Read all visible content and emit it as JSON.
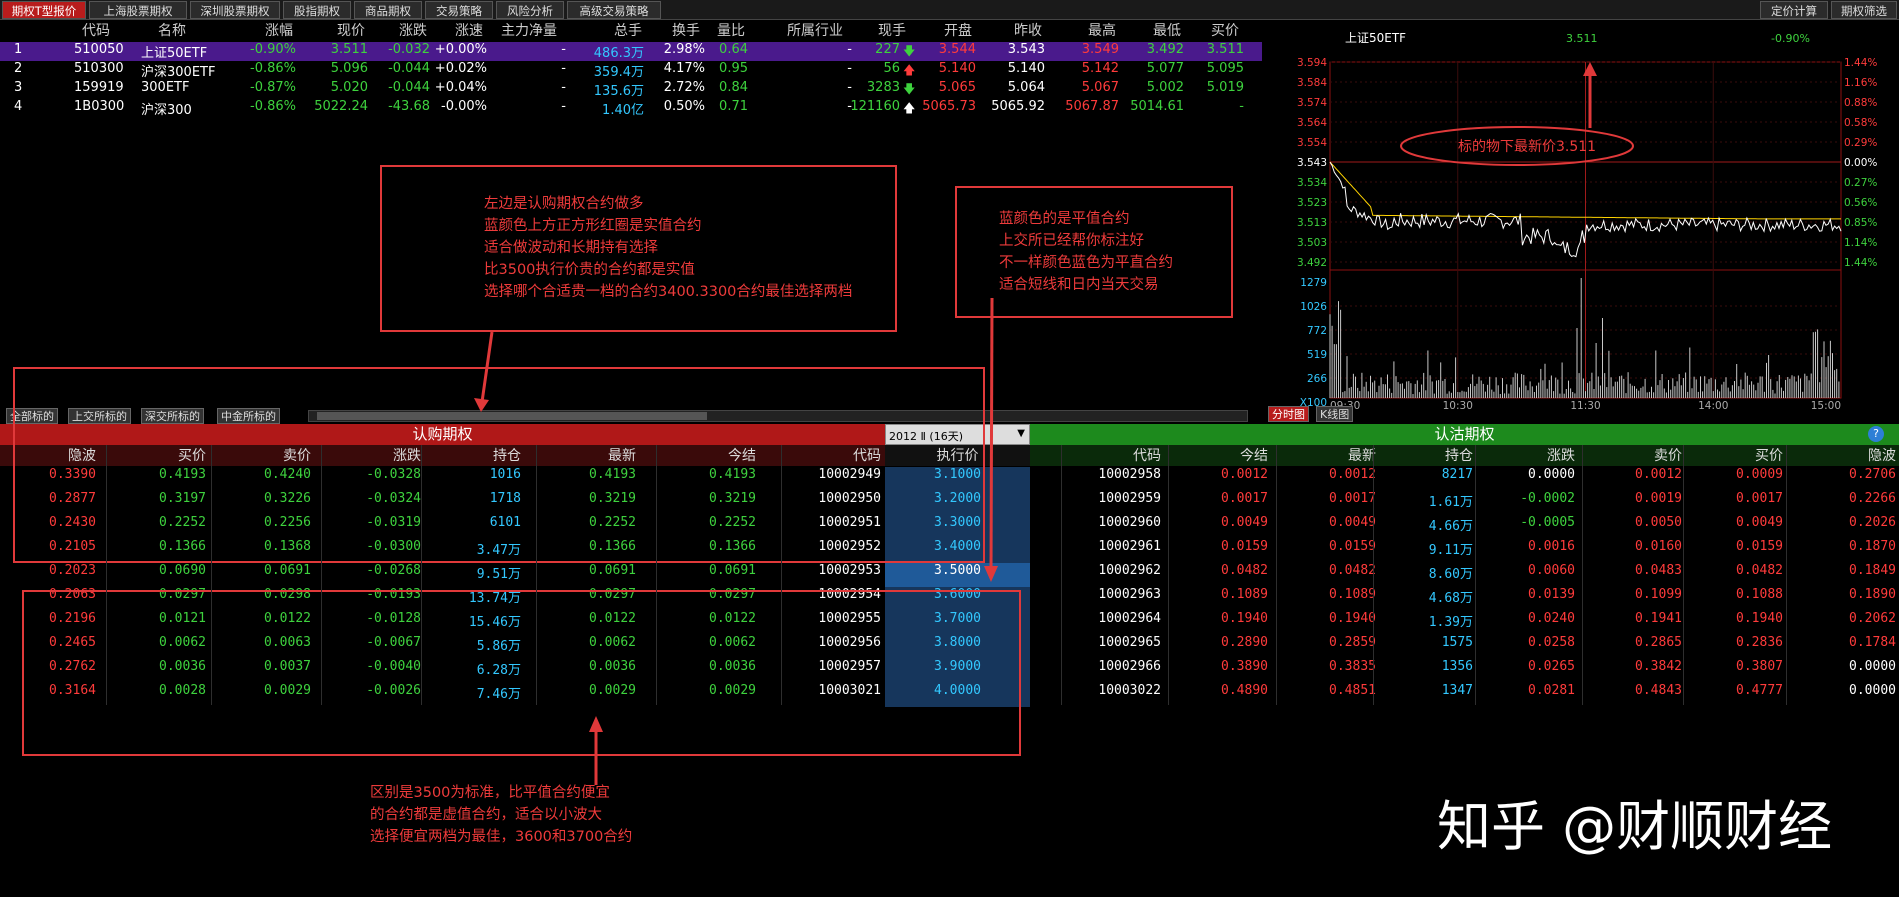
{
  "tabs": [
    "期权T型报价",
    "上海股票期权",
    "深圳股票期权",
    "股指期权",
    "商品期权",
    "交易策略",
    "风险分析",
    "高级交易策略"
  ],
  "right_tabs": [
    "定价计算",
    "期权筛选"
  ],
  "quote_headers": [
    "代码",
    "名称",
    "涨幅",
    "现价",
    "涨跌",
    "涨速",
    "主力净量",
    "总手",
    "换手",
    "量比",
    "所属行业",
    "现手",
    "开盘",
    "昨收",
    "最高",
    "最低",
    "买价"
  ],
  "quotes": [
    {
      "idx": "1",
      "code": "510050",
      "name": "上证50ETF",
      "pct": "-0.90%",
      "price": "3.511",
      "chg": "-0.032",
      "speed": "+0.00%",
      "net": "-",
      "vol": "486.3万",
      "turn": "2.98%",
      "ratio": "0.64",
      "ind": "-",
      "cur": "227",
      "arrow": "down",
      "open": "3.544",
      "prev": "3.543",
      "high": "3.549",
      "low": "3.492",
      "bid": "3.511"
    },
    {
      "idx": "2",
      "code": "510300",
      "name": "沪深300ETF",
      "pct": "-0.86%",
      "price": "5.096",
      "chg": "-0.044",
      "speed": "+0.02%",
      "net": "-",
      "vol": "359.4万",
      "turn": "4.17%",
      "ratio": "0.95",
      "ind": "-",
      "cur": "56",
      "arrow": "up",
      "open": "5.140",
      "prev": "5.140",
      "high": "5.142",
      "low": "5.077",
      "bid": "5.095"
    },
    {
      "idx": "3",
      "code": "159919",
      "name": "300ETF",
      "pct": "-0.87%",
      "price": "5.020",
      "chg": "-0.044",
      "speed": "+0.04%",
      "net": "-",
      "vol": "135.6万",
      "turn": "2.72%",
      "ratio": "0.84",
      "ind": "-",
      "cur": "3283",
      "arrow": "down",
      "open": "5.065",
      "prev": "5.064",
      "high": "5.067",
      "low": "5.002",
      "bid": "5.019"
    },
    {
      "idx": "4",
      "code": "1B0300",
      "name": "沪深300",
      "pct": "-0.86%",
      "price": "5022.24",
      "chg": "-43.68",
      "speed": "-0.00%",
      "net": "-",
      "vol": "1.40亿",
      "turn": "0.50%",
      "ratio": "0.71",
      "ind": "-",
      "cur": "121160",
      "arrow": "up",
      "open": "5065.73",
      "prev": "5065.92",
      "high": "5067.87",
      "low": "5014.61",
      "bid": "-"
    }
  ],
  "annotations": {
    "box1": [
      "左边是认购期权合约做多",
      "蓝颜色上方正方形红圈是实值合约",
      "适合做波动和长期持有选择",
      "比3500执行价贵的合约都是实值",
      "选择哪个合适贵一档的合约3400.3300合约最佳选择两档"
    ],
    "box2": [
      "蓝颜色的是平值合约",
      "上交所已经帮你标注好",
      "不一样颜色蓝色为平直合约",
      "适合短线和日内当天交易"
    ],
    "box3": [
      "区别是3500为标准，比平值合约便宜",
      "的合约都是虚值合约，适合以小波大",
      "选择便宜两档为最佳，3600和3700合约"
    ],
    "ellipse": "标的物下最新价3.511"
  },
  "chart": {
    "title": "上证50ETF",
    "price": "3.511",
    "pct": "-0.90%",
    "price_ticks": [
      "3.594",
      "3.584",
      "3.574",
      "3.564",
      "3.554",
      "3.543",
      "3.534",
      "3.523",
      "3.513",
      "3.503",
      "3.492"
    ],
    "pct_ticks": [
      "1.44%",
      "1.16%",
      "0.88%",
      "0.58%",
      "0.29%",
      "0.00%",
      "0.27%",
      "0.56%",
      "0.85%",
      "1.14%",
      "1.44%"
    ],
    "vol_ticks": [
      "1279",
      "1026",
      "772",
      "519",
      "266",
      "X100"
    ],
    "time_ticks": [
      "09:30",
      "10:30",
      "11:30",
      "14:00",
      "15:00"
    ],
    "tabs": [
      "分时图",
      "K线图"
    ]
  },
  "market_tabs": [
    "全部标的",
    "上交所标的",
    "深交所标的",
    "中金所标的"
  ],
  "call_banner": "认购期权",
  "put_banner": "认沽期权",
  "expiry_select": "2012 Ⅱ  (16天)",
  "call_headers": [
    "隐波",
    "买价",
    "卖价",
    "涨跌",
    "持仓",
    "最新",
    "今结",
    "代码"
  ],
  "strike_header": "执行价",
  "put_headers": [
    "代码",
    "今结",
    "最新",
    "持仓",
    "涨跌",
    "卖价",
    "买价",
    "隐波"
  ],
  "options": [
    {
      "c": [
        "0.3390",
        "0.4193",
        "0.4240",
        "-0.0328",
        "1016",
        "0.4193",
        "0.4193",
        "10002949"
      ],
      "k": "3.1000",
      "p": [
        "10002958",
        "0.0012",
        "0.0012",
        "8217",
        "0.0000",
        "0.0012",
        "0.0009",
        "0.2706"
      ]
    },
    {
      "c": [
        "0.2877",
        "0.3197",
        "0.3226",
        "-0.0324",
        "1718",
        "0.3219",
        "0.3219",
        "10002950"
      ],
      "k": "3.2000",
      "p": [
        "10002959",
        "0.0017",
        "0.0017",
        "1.61万",
        "-0.0002",
        "0.0019",
        "0.0017",
        "0.2266"
      ]
    },
    {
      "c": [
        "0.2430",
        "0.2252",
        "0.2256",
        "-0.0319",
        "6101",
        "0.2252",
        "0.2252",
        "10002951"
      ],
      "k": "3.3000",
      "p": [
        "10002960",
        "0.0049",
        "0.0049",
        "4.66万",
        "-0.0005",
        "0.0050",
        "0.0049",
        "0.2026"
      ]
    },
    {
      "c": [
        "0.2105",
        "0.1366",
        "0.1368",
        "-0.0300",
        "3.47万",
        "0.1366",
        "0.1366",
        "10002952"
      ],
      "k": "3.4000",
      "p": [
        "10002961",
        "0.0159",
        "0.0159",
        "9.11万",
        "0.0016",
        "0.0160",
        "0.0159",
        "0.1870"
      ]
    },
    {
      "c": [
        "0.2023",
        "0.0690",
        "0.0691",
        "-0.0268",
        "9.51万",
        "0.0691",
        "0.0691",
        "10002953"
      ],
      "k": "3.5000",
      "p": [
        "10002962",
        "0.0482",
        "0.0482",
        "8.60万",
        "0.0060",
        "0.0483",
        "0.0482",
        "0.1849"
      ],
      "atm": true
    },
    {
      "c": [
        "0.2063",
        "0.0297",
        "0.0298",
        "-0.0193",
        "13.74万",
        "0.0297",
        "0.0297",
        "10002954"
      ],
      "k": "3.6000",
      "p": [
        "10002963",
        "0.1089",
        "0.1089",
        "4.68万",
        "0.0139",
        "0.1099",
        "0.1088",
        "0.1890"
      ]
    },
    {
      "c": [
        "0.2196",
        "0.0121",
        "0.0122",
        "-0.0128",
        "15.46万",
        "0.0122",
        "0.0122",
        "10002955"
      ],
      "k": "3.7000",
      "p": [
        "10002964",
        "0.1940",
        "0.1940",
        "1.39万",
        "0.0240",
        "0.1941",
        "0.1940",
        "0.2062"
      ]
    },
    {
      "c": [
        "0.2465",
        "0.0062",
        "0.0063",
        "-0.0067",
        "5.86万",
        "0.0062",
        "0.0062",
        "10002956"
      ],
      "k": "3.8000",
      "p": [
        "10002965",
        "0.2890",
        "0.2859",
        "1575",
        "0.0258",
        "0.2865",
        "0.2836",
        "0.1784"
      ]
    },
    {
      "c": [
        "0.2762",
        "0.0036",
        "0.0037",
        "-0.0040",
        "6.28万",
        "0.0036",
        "0.0036",
        "10002957"
      ],
      "k": "3.9000",
      "p": [
        "10002966",
        "0.3890",
        "0.3835",
        "1356",
        "0.0265",
        "0.3842",
        "0.3807",
        "0.0000"
      ]
    },
    {
      "c": [
        "0.3164",
        "0.0028",
        "0.0029",
        "-0.0026",
        "7.46万",
        "0.0029",
        "0.0029",
        "10003021"
      ],
      "k": "4.0000",
      "p": [
        "10003022",
        "0.4890",
        "0.4851",
        "1347",
        "0.0281",
        "0.4843",
        "0.4777",
        "0.0000"
      ]
    }
  ],
  "watermark": "知乎 @财顺财经",
  "colors": {
    "up": "#ff3b3b",
    "down": "#3ed23e",
    "call_banner": "#b01818",
    "put_banner": "#1d8a1d",
    "strike_bg": "#16365c",
    "atm_bg": "#1f5a99",
    "annotation": "#e0393a"
  }
}
